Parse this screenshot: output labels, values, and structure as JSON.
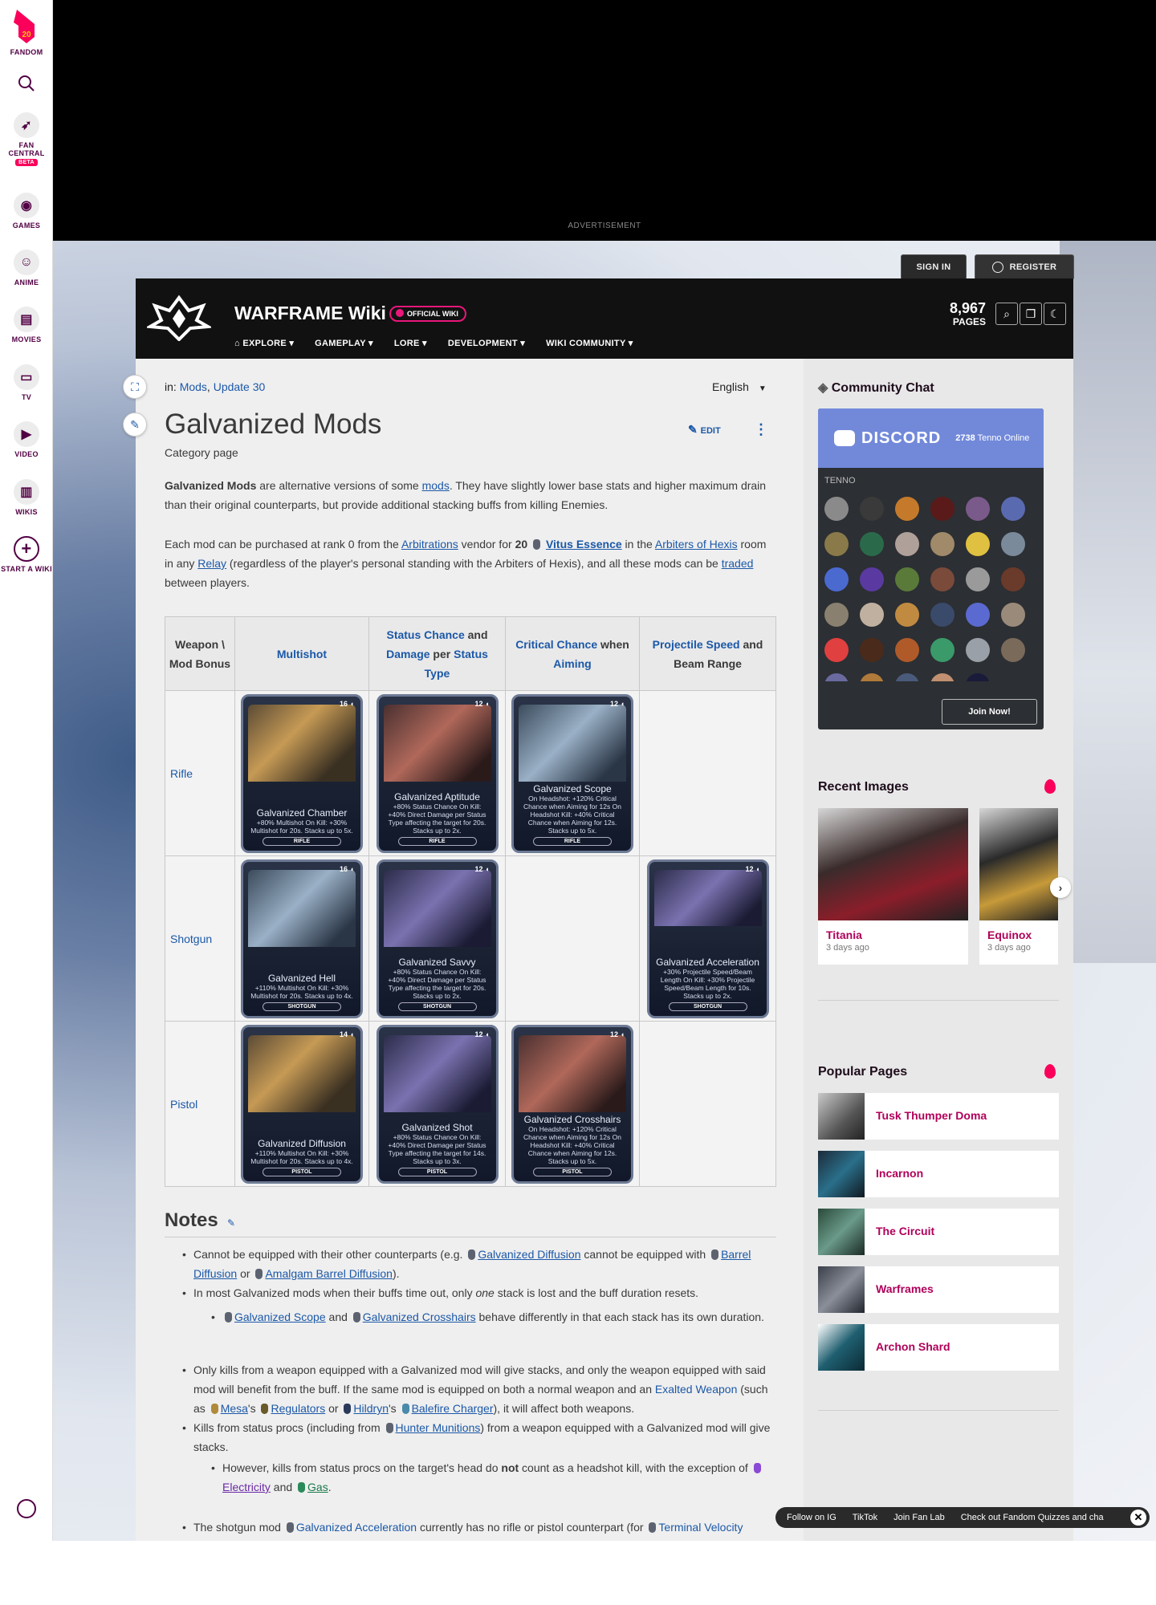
{
  "rail": {
    "logo_text": "20",
    "fandom": "FANDOM",
    "fan_central": "FAN CENTRAL",
    "beta": "BETA",
    "games": "GAMES",
    "anime": "ANIME",
    "movies": "MOVIES",
    "tv": "TV",
    "video": "VIDEO",
    "wikis": "WIKIS",
    "start_wiki": "START A WIKI"
  },
  "ad": {
    "label": "ADVERTISEMENT"
  },
  "auth": {
    "sign_in": "SIGN IN",
    "register": "REGISTER"
  },
  "wiki": {
    "title": "WARFRAME Wiki",
    "official": "OFFICIAL WIKI",
    "nav": [
      "EXPLORE",
      "GAMEPLAY",
      "LORE",
      "DEVELOPMENT",
      "WIKI COMMUNITY"
    ],
    "pages_count": "8,967",
    "pages_label": "PAGES"
  },
  "page": {
    "in_label": "in:",
    "cat1": "Mods",
    "cat2": "Update 30",
    "language": "English",
    "title": "Galvanized Mods",
    "subtitle": "Category page",
    "edit": "EDIT",
    "intro1_bold": "Galvanized Mods",
    "intro1_a": " are alternative versions of some ",
    "intro1_link": "mods",
    "intro1_b": ". They have slightly lower base stats and higher maximum drain than their original counterparts, but provide additional stacking buffs from killing Enemies.",
    "intro2_a": "Each mod can be purchased at rank 0 from the ",
    "intro2_link1": "Arbitrations",
    "intro2_b": " vendor for ",
    "intro2_num": "20",
    "intro2_link2": "Vitus Essence",
    "intro2_c": " in the ",
    "intro2_link3": "Arbiters of Hexis",
    "intro2_d": " room in any ",
    "intro2_link4": "Relay",
    "intro2_e": " (regardless of the player's personal standing with the Arbiters of Hexis), and all these mods can be ",
    "intro2_link5": "traded",
    "intro2_f": " between players."
  },
  "table": {
    "h0": "Weapon \\ Mod Bonus",
    "h1": "Multishot",
    "h2_a": "Status Chance",
    "h2_b": " and ",
    "h2_c": "Damage",
    "h2_d": " per ",
    "h2_e": "Status Type",
    "h3_a": "Critical Chance",
    "h3_b": " when ",
    "h3_c": "Aiming",
    "h4_a": "Projectile Speed",
    "h4_b": " and Beam Range",
    "rows": [
      {
        "weapon": "Rifle",
        "cards": [
          {
            "rank": "16",
            "name": "Galvanized Chamber",
            "desc": "+80% Multishot On Kill: +30% Multishot for 20s. Stacks up to 5x.",
            "tag": "RIFLE"
          },
          {
            "rank": "12",
            "name": "Galvanized Aptitude",
            "desc": "+80% Status Chance On Kill: +40% Direct Damage per Status Type affecting the target for 20s. Stacks up to 2x.",
            "tag": "RIFLE"
          },
          {
            "rank": "12",
            "name": "Galvanized Scope",
            "desc": "On Headshot: +120% Critical Chance when Aiming for 12s On Headshot Kill: +40% Critical Chance when Aiming for 12s. Stacks up to 5x.",
            "tag": "RIFLE"
          }
        ]
      },
      {
        "weapon": "Shotgun",
        "cards": [
          {
            "rank": "16",
            "name": "Galvanized Hell",
            "desc": "+110% Multishot On Kill: +30% Multishot for 20s. Stacks up to 4x.",
            "tag": "SHOTGUN"
          },
          {
            "rank": "12",
            "name": "Galvanized Savvy",
            "desc": "+80% Status Chance On Kill: +40% Direct Damage per Status Type affecting the target for 20s. Stacks up to 2x.",
            "tag": "SHOTGUN"
          },
          {
            "rank": "12",
            "name": "Galvanized Acceleration",
            "desc": "+30% Projectile Speed/Beam Length On Kill: +30% Projectile Speed/Beam Length for 10s. Stacks up to 2x.",
            "tag": "SHOTGUN"
          }
        ]
      },
      {
        "weapon": "Pistol",
        "cards": [
          {
            "rank": "14",
            "name": "Galvanized Diffusion",
            "desc": "+110% Multishot On Kill: +30% Multishot for 20s. Stacks up to 4x.",
            "tag": "PISTOL"
          },
          {
            "rank": "12",
            "name": "Galvanized Shot",
            "desc": "+80% Status Chance On Kill: +40% Direct Damage per Status Type affecting the target for 14s. Stacks up to 3x.",
            "tag": "PISTOL"
          },
          {
            "rank": "12",
            "name": "Galvanized Crosshairs",
            "desc": "On Headshot: +120% Critical Chance when Aiming for 12s On Headshot Kill: +40% Critical Chance when Aiming for 12s. Stacks up to 5x.",
            "tag": "PISTOL"
          }
        ]
      }
    ]
  },
  "notes": {
    "title": "Notes",
    "n1_a": "Cannot be equipped with their other counterparts (e.g. ",
    "n1_l1": "Galvanized Diffusion",
    "n1_b": " cannot be equipped with ",
    "n1_l2": "Barrel Diffusion",
    "n1_c": " or ",
    "n1_l3": "Amalgam Barrel Diffusion",
    "n1_d": ").",
    "n2_a": "In most Galvanized mods when their buffs time out, only ",
    "n2_em": "one",
    "n2_b": " stack is lost and the buff duration resets.",
    "n3_l1": "Galvanized Scope",
    "n3_a": " and ",
    "n3_l2": "Galvanized Crosshairs",
    "n3_b": " behave differently in that each stack has its own duration.",
    "n4_a": "Only kills from a weapon equipped with a Galvanized mod will give stacks, and only the weapon equipped with said mod will benefit from the buff. If the same mod is equipped on both a normal weapon and an ",
    "n4_l1": "Exalted Weapon",
    "n4_b": " (such as ",
    "n4_l2": "Mesa",
    "n4_c": "'s ",
    "n4_l3": "Regulators",
    "n4_d": " or ",
    "n4_l4": "Hildryn",
    "n4_e": "'s ",
    "n4_l5": "Balefire Charger",
    "n4_f": "), it will affect both weapons.",
    "n5_a": "Kills from status procs (including from ",
    "n5_l1": "Hunter Munitions",
    "n5_b": ") from a weapon equipped with a Galvanized mod will give stacks.",
    "n6_a": "However, kills from status procs on the target's head do ",
    "n6_bold": "not",
    "n6_b": " count as a headshot kill, with the exception of ",
    "n6_l1": "Electricity",
    "n6_c": " and ",
    "n6_l2": "Gas",
    "n6_d": ".",
    "n7_a": "The shotgun mod ",
    "n7_l1": "Galvanized Acceleration",
    "n7_b": " currently has no rifle or pistol counterpart (for ",
    "n7_l2": "Terminal Velocity"
  },
  "right": {
    "community_chat": "Community Chat",
    "discord": "DISCORD",
    "online_count": "2738",
    "online_label": "Tenno Online",
    "tenno": "TENNO",
    "join": "Join Now!",
    "recent_images": "Recent Images",
    "img1_title": "Titania",
    "img1_date": "3 days ago",
    "img2_title": "Equinox",
    "img2_date": "3 days ago",
    "popular": "Popular Pages",
    "pop": [
      "Tusk Thumper Doma",
      "Incarnon",
      "The Circuit",
      "Warframes",
      "Archon Shard"
    ]
  },
  "gbar": [
    "Follow on IG",
    "TikTok",
    "Join Fan Lab",
    "Check out Fandom Quizzes and cha"
  ],
  "colors": {
    "fandom_pink": "#fa005a",
    "link": "#1b58a8",
    "discord": "#7289da",
    "header": "#111111"
  }
}
